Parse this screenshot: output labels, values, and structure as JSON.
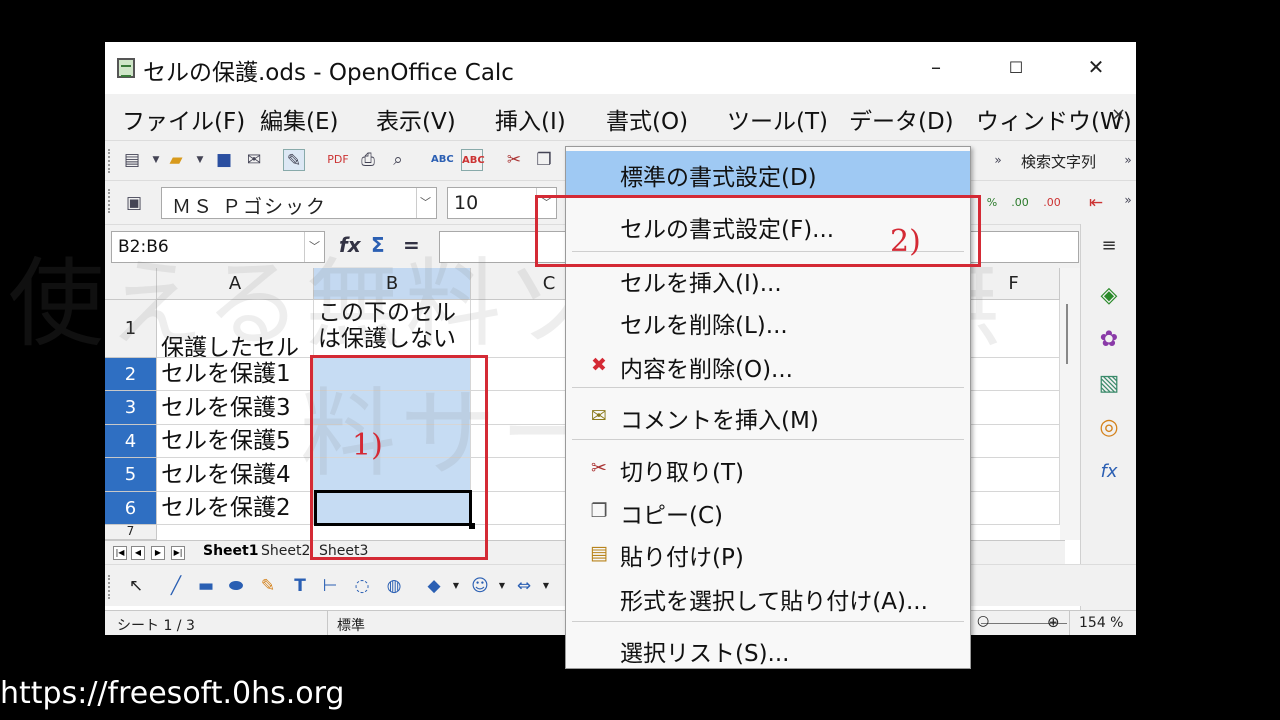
{
  "window": {
    "title": "セルの保護.ods - OpenOffice Calc",
    "minimize": "–",
    "maximize": "☐",
    "close": "✕"
  },
  "menubar": {
    "items": [
      "ファイル(F)",
      "編集(E)",
      "表示(V)",
      "挿入(I)",
      "書式(O)",
      "ツール(T)",
      "データ(D)",
      "ウィンドウ(W)"
    ],
    "close_doc": "×"
  },
  "toolbar": {
    "search_label": "検索文字列",
    "font_name": "ＭＳ Ｐゴシック",
    "font_size": "10"
  },
  "formula": {
    "name_box": "B2:B6",
    "fx": "fx",
    "sigma": "Σ",
    "equals": "="
  },
  "grid": {
    "columns": [
      "A",
      "B",
      "C",
      "F"
    ],
    "rows": [
      "1",
      "2",
      "3",
      "4",
      "5",
      "6",
      "7"
    ],
    "cells": {
      "a1": "保護したセル",
      "b1": "この下のセルは保護しない",
      "a2": "セルを保護1",
      "a3": "セルを保護3",
      "a4": "セルを保護5",
      "a5": "セルを保護4",
      "a6": "セルを保護2"
    }
  },
  "sheets": [
    "Sheet1",
    "Sheet2",
    "Sheet3"
  ],
  "status": {
    "sheet": "シート 1 / 3",
    "style": "標準",
    "zoom": "154 %"
  },
  "context_menu": {
    "items": [
      {
        "label": "標準の書式設定(D)",
        "icon": ""
      },
      {
        "label": "セルの書式設定(F)...",
        "icon": ""
      },
      {
        "label": "セルを挿入(I)...",
        "icon": ""
      },
      {
        "label": "セルを削除(L)...",
        "icon": ""
      },
      {
        "label": "内容を削除(O)...",
        "icon": "delete-x-icon"
      },
      {
        "label": "コメントを挿入(M)",
        "icon": "comment-icon"
      },
      {
        "label": "切り取り(T)",
        "icon": "scissors-icon"
      },
      {
        "label": "コピー(C)",
        "icon": "copy-icon"
      },
      {
        "label": "貼り付け(P)",
        "icon": "paste-icon"
      },
      {
        "label": "形式を選択して貼り付け(A)...",
        "icon": ""
      },
      {
        "label": "選択リスト(S)...",
        "icon": ""
      }
    ]
  },
  "annotations": {
    "step1": "1)",
    "step2": "2)"
  },
  "watermark": {
    "line1": "使える無料ソフト＆無",
    "line2": "料サービス"
  },
  "footer": {
    "url": "https://freesoft.0hs.org"
  },
  "colors": {
    "accent_red": "#d42a35",
    "selection": "#c6dcf3",
    "menu_highlight": "#9fc9f3",
    "row_selected": "#2f6fc2"
  }
}
